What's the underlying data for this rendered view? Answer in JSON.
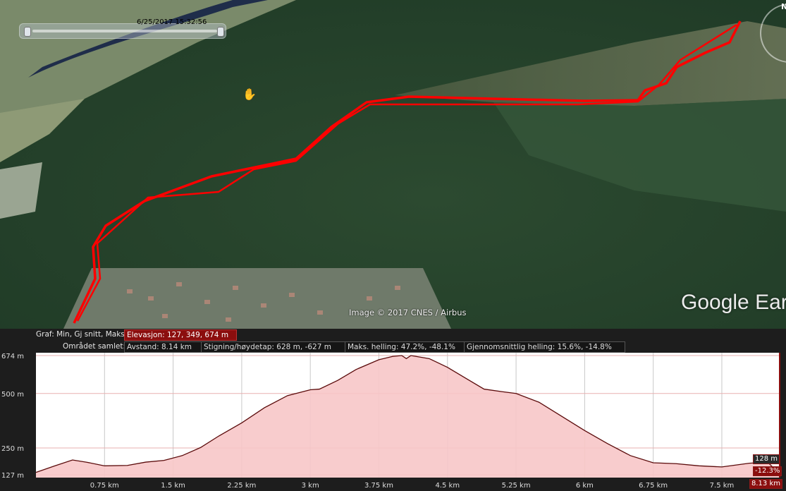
{
  "map": {
    "timestamp": "6/25/2017  15:32:56",
    "attribution": "Image © 2017 CNES / Airbus",
    "brand": "Google Earth",
    "compass_label": "N",
    "hand_icon": "hand-pan-icon",
    "track_color": "#ff0000"
  },
  "stats": {
    "graph_label": "Graf: Min, Gj snitt, Maks:",
    "elevation": "Elevasjon: 127, 349, 674 m",
    "area_label": "Området samlet:",
    "distance": "Avstand: 8.14 km",
    "climb": "Stigning/høydetap: 628 m, -627 m",
    "max_slope": "Maks. helling: 47.2%, -48.1%",
    "avg_slope": "Gjennomsnittlig helling: 15.6%, -14.8%"
  },
  "profile": {
    "current_elevation": "128 m",
    "current_slope": "-12.3%",
    "current_distance": "8.13 km"
  },
  "chart_data": {
    "type": "area",
    "title": "",
    "xlabel": "",
    "ylabel": "",
    "xlim": [
      0,
      8.14
    ],
    "ylim": [
      127,
      674
    ],
    "yticks": [
      {
        "label": "674 m",
        "value": 674
      },
      {
        "label": "500 m",
        "value": 500
      },
      {
        "label": "250 m",
        "value": 250
      },
      {
        "label": "127 m",
        "value": 127
      }
    ],
    "xticks": [
      {
        "label": "0.75 km",
        "value": 0.75
      },
      {
        "label": "1.5 km",
        "value": 1.5
      },
      {
        "label": "2.25 km",
        "value": 2.25
      },
      {
        "label": "3 km",
        "value": 3.0
      },
      {
        "label": "3.75 km",
        "value": 3.75
      },
      {
        "label": "4.5 km",
        "value": 4.5
      },
      {
        "label": "5.25 km",
        "value": 5.25
      },
      {
        "label": "6 km",
        "value": 6.0
      },
      {
        "label": "6.75 km",
        "value": 6.75
      },
      {
        "label": "7.5 km",
        "value": 7.5
      }
    ],
    "fill_color": "#f7c6c8",
    "line_color": "#5a0a0a",
    "grid": true,
    "x": [
      0,
      0.2,
      0.4,
      0.55,
      0.75,
      1.0,
      1.2,
      1.4,
      1.6,
      1.8,
      2.0,
      2.25,
      2.5,
      2.75,
      3.0,
      3.1,
      3.3,
      3.5,
      3.75,
      3.9,
      4.0,
      4.05,
      4.1,
      4.3,
      4.5,
      4.7,
      4.9,
      5.1,
      5.25,
      5.5,
      5.75,
      6.0,
      6.25,
      6.5,
      6.75,
      7.0,
      7.25,
      7.5,
      7.8,
      8.0,
      8.14
    ],
    "y": [
      138,
      167,
      195,
      185,
      168,
      170,
      185,
      193,
      215,
      252,
      305,
      365,
      435,
      490,
      517,
      520,
      560,
      610,
      655,
      670,
      674,
      660,
      674,
      660,
      620,
      570,
      520,
      508,
      500,
      460,
      395,
      330,
      270,
      215,
      182,
      178,
      168,
      163,
      180,
      185,
      128
    ]
  }
}
